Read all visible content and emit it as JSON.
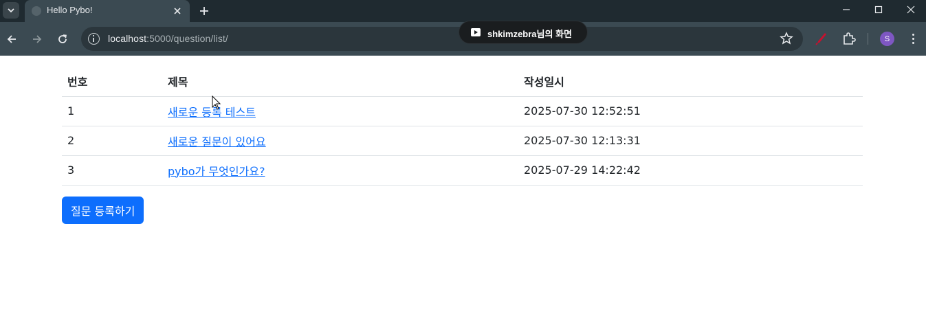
{
  "browser": {
    "tab_title": "Hello Pybo!",
    "url_host": "localhost",
    "url_path": ":5000/question/list/",
    "screen_share_label": "shkimzebra님의 화면",
    "profile_initial": "S",
    "colors": {
      "frame": "#1f2a30",
      "toolbar": "#3b4a52",
      "omnibox": "#2b363c",
      "profile": "#7e57c2"
    }
  },
  "table": {
    "headers": {
      "num": "번호",
      "subject": "제목",
      "date": "작성일시"
    },
    "rows": [
      {
        "num": "1",
        "subject": "새로운 등록 테스트",
        "date": "2025-07-30 12:52:51"
      },
      {
        "num": "2",
        "subject": "새로운 질문이 있어요",
        "date": "2025-07-30 12:13:31"
      },
      {
        "num": "3",
        "subject": "pybo가 무엇인가요?",
        "date": "2025-07-29 14:22:42"
      }
    ]
  },
  "actions": {
    "create_question_label": "질문 등록하기"
  },
  "colors": {
    "primary": "#0d6efd",
    "link": "#0d6efd",
    "border": "#dee2e6"
  }
}
